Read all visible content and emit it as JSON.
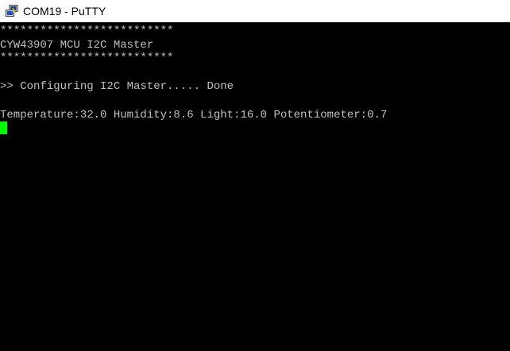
{
  "window": {
    "title": "COM19 - PuTTY",
    "icon": "putty-terminal-icon"
  },
  "terminal": {
    "lines": [
      "**************************",
      "CYW43907 MCU I2C Master",
      "**************************",
      ">> Configuring I2C Master..... Done",
      "Temperature:32.0 Humidity:8.6 Light:16.0 Potentiometer:0.7"
    ],
    "colors": {
      "background": "#000000",
      "foreground": "#c0c0c0",
      "cursor": "#00ff00"
    }
  }
}
